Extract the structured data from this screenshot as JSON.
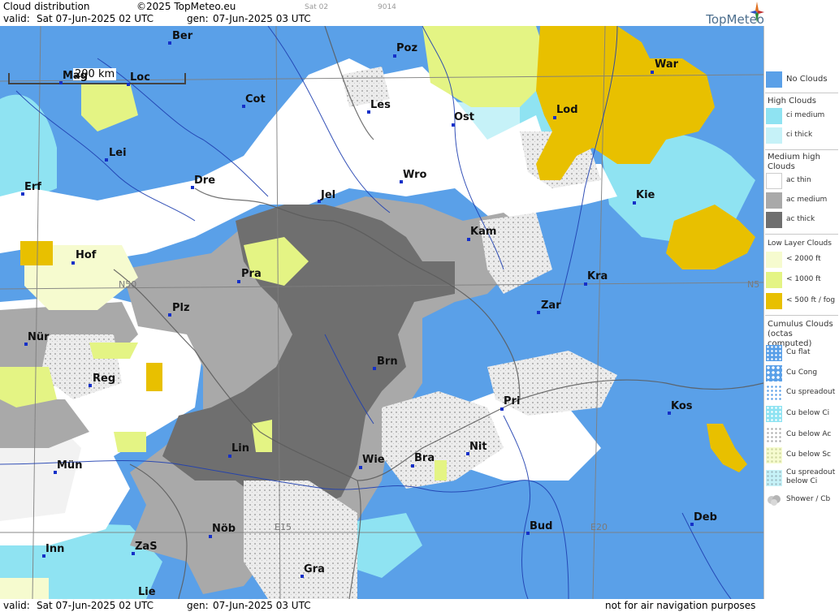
{
  "header": {
    "title": "Cloud distribution",
    "copyright": "©2025 TopMeteo.eu",
    "sat": "Sat 02",
    "code": "9014",
    "valid_label": "valid:",
    "valid_value": "Sat  07-Jun-2025  02 UTC",
    "gen_label": "gen:",
    "gen_value": "07-Jun-2025 03 UTC",
    "brand": "TopMeteo"
  },
  "footer": {
    "valid_label": "valid:",
    "valid_value": "Sat  07-Jun-2025  02 UTC",
    "gen_label": "gen:",
    "gen_value": "07-Jun-2025 03 UTC",
    "notice": "not for air navigation purposes"
  },
  "scale_label": "200 km",
  "grid_labels": {
    "n50": "N50",
    "n5": "N5",
    "e15": "E15",
    "e20": "E20"
  },
  "cities": {
    "ber": "Ber",
    "poz": "Poz",
    "war": "War",
    "mag": "Mag",
    "loc": "Loc",
    "cot": "Cot",
    "les": "Les",
    "ost": "Ost",
    "lod": "Lod",
    "lei": "Lei",
    "erf": "Erf",
    "dre": "Dre",
    "wro": "Wro",
    "jel": "Jel",
    "kie": "Kie",
    "kam": "Kam",
    "hof": "Hof",
    "pra": "Pra",
    "kra": "Kra",
    "zar": "Zar",
    "plz": "Plz",
    "nur": "Nür",
    "brn": "Brn",
    "reg": "Reg",
    "pri": "Pri",
    "kos": "Kos",
    "lin": "Lin",
    "nit": "Nit",
    "bra": "Bra",
    "wie": "Wie",
    "mun": "Mün",
    "bud": "Bud",
    "deb": "Deb",
    "nob": "Nöb",
    "inn": "Inn",
    "zas": "ZaS",
    "gra": "Gra",
    "lie": "Lie"
  },
  "legend": {
    "no_clouds": "No Clouds",
    "high_head": "High Clouds",
    "ci_medium": "ci medium",
    "ci_thick": "ci thick",
    "medium_head": "Medium high Clouds",
    "ac_thin": "ac thin",
    "ac_medium": "ac medium",
    "ac_thick": "ac thick",
    "low_head": "Low Layer Clouds",
    "lt2000": "< 2000 ft",
    "lt1000": "< 1000 ft",
    "lt500": "< 500 ft / fog",
    "cu_head": "Cumulus Clouds (octas computed)",
    "cu_flat": "Cu flat",
    "cu_cong": "Cu Cong",
    "cu_spreadout": "Cu spreadout",
    "cu_below_ci": "Cu below Ci",
    "cu_below_ac": "Cu below Ac",
    "cu_below_sc": "Cu below Sc",
    "cu_spreadout_below_ci": "Cu spreadout below Ci",
    "shower_cb": "Shower / Cb"
  },
  "colors": {
    "no_clouds": "#5aa0e8",
    "ci_medium": "#8fe3f2",
    "ci_thick": "#c6f2f8",
    "ac_thin": "#ffffff",
    "ac_medium": "#a9a9a9",
    "ac_thick": "#6f6f6f",
    "lt2000": "#f6fbcf",
    "lt1000": "#e4f484",
    "lt500": "#e8c000"
  }
}
